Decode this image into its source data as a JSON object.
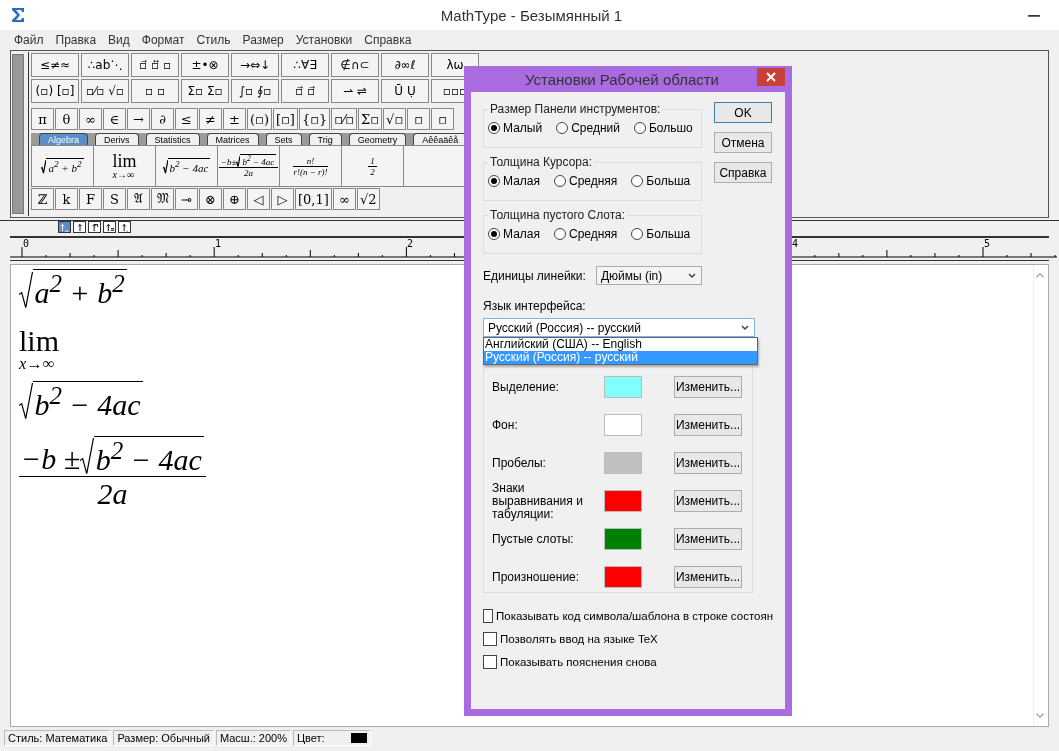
{
  "window": {
    "title": "MathType - Безымянный 1"
  },
  "menu": [
    "Файл",
    "Правка",
    "Вид",
    "Формат",
    "Стиль",
    "Размер",
    "Установки",
    "Справка"
  ],
  "palette": {
    "row_1": [
      "≤≠≈",
      "∴ab⋱",
      "▫⃗ ▫⃡ ▫",
      "±•⊗",
      "→⇔↓",
      "∴∀∃",
      "∉∩⊂",
      "∂∞ℓ",
      "λω"
    ],
    "row_2": [
      "(▫) [▫]",
      "▫⁄▫ √▫",
      "▫ ▫",
      "Σ▫ Σ▫",
      "∫▫ ∮▫",
      "▫⃗ ▫⃗",
      "⇀ ⇌",
      "Ū Ụ",
      "▫▫▫"
    ],
    "symbols": [
      "π",
      "θ",
      "∞",
      "∈",
      "→",
      "∂",
      "≤",
      "≠",
      "±",
      "(▫)",
      "[▫]",
      "{▫}",
      "▫⁄▫",
      "Σ▫",
      "√▫",
      "▫",
      "▫"
    ],
    "tabs": [
      {
        "label": "Algebra",
        "selected": true
      },
      {
        "label": "Derivs",
        "selected": false
      },
      {
        "label": "Statistics",
        "selected": false
      },
      {
        "label": "Matrices",
        "selected": false
      },
      {
        "label": "Sets",
        "selected": false
      },
      {
        "label": "Trig",
        "selected": false
      },
      {
        "label": "Geometry",
        "selected": false
      },
      {
        "label": "Aêêaäêå",
        "selected": false
      }
    ],
    "templates": [
      {
        "kind": "root",
        "body": "a$^{2}$ + b$^{2}$"
      },
      {
        "kind": "limit",
        "main": "lim",
        "sub": "x→∞"
      },
      {
        "kind": "root",
        "body": "b$^{2}$ − 4ac"
      },
      {
        "kind": "fraction",
        "top": [
          {
            "kind": "text",
            "text": "−b±"
          },
          {
            "kind": "root",
            "body": "b$^{2}$ − 4ac"
          }
        ],
        "bottom": [
          {
            "kind": "text",
            "text": "2a"
          }
        ]
      },
      {
        "kind": "fraction",
        "top": [
          {
            "kind": "text",
            "text": "n!"
          }
        ],
        "bottom": [
          {
            "kind": "text",
            "text": "r!(n − r)!"
          }
        ]
      },
      {
        "kind": "fraction",
        "top": [
          {
            "kind": "text",
            "text": "1"
          }
        ],
        "bottom": [
          {
            "kind": "text",
            "text": "2"
          }
        ]
      }
    ],
    "row_bottom": [
      "ℤ",
      "k",
      "F",
      "S",
      "𝔄",
      "𝔐",
      "⊸",
      "⊗",
      "⊕",
      "◁",
      "▷",
      "[0,1]",
      "∞",
      "√2"
    ]
  },
  "nudge_buttons": [
    {
      "selected": true
    },
    {
      "selected": false
    },
    {
      "selected": false
    },
    {
      "selected": false
    },
    {
      "selected": false
    }
  ],
  "ruler": {
    "labels": [
      "0",
      "1",
      "2",
      "4",
      "5"
    ]
  },
  "document": {
    "formulas": [
      {
        "kind": "root",
        "body": "a$^{2}$ + b$^{2}$"
      },
      {
        "kind": "limit",
        "main": "lim",
        "sub": "x→∞"
      },
      {
        "kind": "root",
        "body": "b$^{2}$ − 4ac"
      },
      {
        "kind": "fraction",
        "top": [
          {
            "kind": "text",
            "text": "−b ±"
          },
          {
            "kind": "root",
            "body": "b$^{2}$ − 4ac"
          }
        ],
        "bottom": [
          {
            "kind": "text",
            "text": "2a"
          }
        ]
      }
    ]
  },
  "dialog": {
    "title": "Установки Рабочей области",
    "groups": [
      {
        "legend": "Размер Панели инструментов:",
        "options": [
          {
            "label": "Малый",
            "selected": true
          },
          {
            "label": "Средний",
            "selected": false
          },
          {
            "label": "Большо",
            "selected": false
          }
        ]
      },
      {
        "legend": "Толщина Курсора:",
        "options": [
          {
            "label": "Малая",
            "selected": true
          },
          {
            "label": "Средняя",
            "selected": false
          },
          {
            "label": "Больша",
            "selected": false
          }
        ]
      },
      {
        "legend": "Толщина пустого Слота:",
        "options": [
          {
            "label": "Малая",
            "selected": true
          },
          {
            "label": "Средняя",
            "selected": false
          },
          {
            "label": "Больша",
            "selected": false
          }
        ]
      }
    ],
    "buttons": [
      "OK",
      "Отмена",
      "Справка"
    ],
    "units": {
      "label": "Единицы линейки:",
      "value": "Дюймы (in)"
    },
    "language": {
      "label": "Язык интерфейса:",
      "value": "Русский (Россия)  --  русский",
      "options": [
        {
          "label": "Английский (США)  --  English",
          "selected": false
        },
        {
          "label": "Русский (Россия)  --  русский",
          "selected": true
        }
      ]
    },
    "colors": [
      {
        "label": "Выделение:",
        "color": "#80ffff",
        "button": "Изменить..."
      },
      {
        "label": "Фон:",
        "color": "#ffffff",
        "button": "Изменить..."
      },
      {
        "label": "Пробелы:",
        "color": "#c0c0c0",
        "button": "Изменить..."
      },
      {
        "label": "Знаки выравнивания и табуляции:",
        "color": "#ff0000",
        "button": "Изменить..."
      },
      {
        "label": "Пустые слоты:",
        "color": "#008000",
        "button": "Изменить..."
      },
      {
        "label": "Произношение:",
        "color": "#ff0000",
        "button": "Изменить..."
      }
    ],
    "checkboxes": [
      {
        "label": "Показывать код символа/шаблона в строке состоян",
        "checked": false
      },
      {
        "label": "Позволять ввод на языке TeX",
        "checked": false
      },
      {
        "label": "Показывать пояснения снова",
        "checked": false
      }
    ]
  },
  "status_bar": {
    "style": "Стиль: Математика",
    "size": "Размер: Обычный",
    "zoom": "Масш.: 200%",
    "color_label": "Цвет:",
    "color": "#000000"
  }
}
